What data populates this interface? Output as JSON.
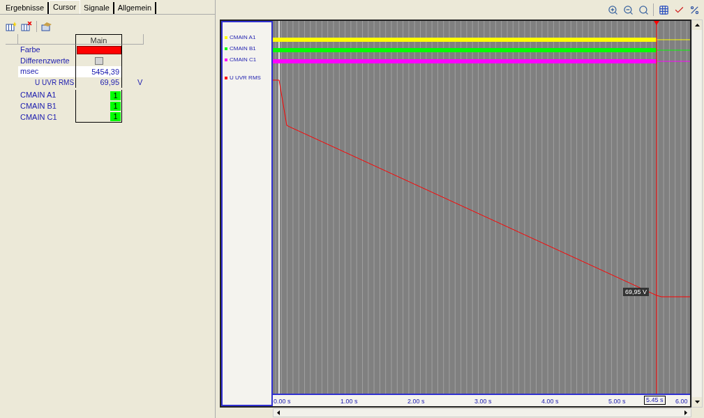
{
  "tabs": [
    {
      "label": "Ergebnisse",
      "selected": false
    },
    {
      "label": "Cursor",
      "selected": true
    },
    {
      "label": "Signale",
      "selected": false
    },
    {
      "label": "Allgemein",
      "selected": false
    }
  ],
  "cursor_table": {
    "column_header": "Main",
    "rows": [
      {
        "kind": "color",
        "label": "Farbe",
        "color": "#ff0000"
      },
      {
        "kind": "checkbox",
        "label": "Differenzwerte",
        "checked": false
      },
      {
        "kind": "time",
        "label": "msec",
        "value": "5454,39",
        "selected": true
      },
      {
        "kind": "signal",
        "label": "U UVR RMS",
        "value": "69,95",
        "unit": "V"
      },
      {
        "kind": "flag",
        "label": "CMAIN A1",
        "value": "1",
        "color": "#00ff00"
      },
      {
        "kind": "flag",
        "label": "CMAIN B1",
        "value": "1",
        "color": "#00ff00"
      },
      {
        "kind": "flag",
        "label": "CMAIN C1",
        "value": "1",
        "color": "#00ff00"
      }
    ]
  },
  "plot": {
    "legend": [
      {
        "kind": "digital",
        "label": "CMAIN A1",
        "color": "#ffff00"
      },
      {
        "kind": "digital",
        "label": "CMAIN B1",
        "color": "#00ff00"
      },
      {
        "kind": "digital",
        "label": "CMAIN C1",
        "color": "#ff00ff"
      },
      {
        "kind": "analog",
        "label": "U UVR RMS",
        "color": "#ff0000"
      }
    ],
    "x_axis_labels": [
      "0.00 s",
      "1.00 s",
      "2.00 s",
      "3.00 s",
      "4.00 s",
      "5.00 s",
      "6.00"
    ],
    "cursor_value": "69,95 V",
    "cursor_time": "5.45 s"
  }
}
